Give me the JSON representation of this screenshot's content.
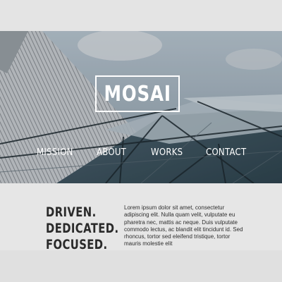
{
  "brand": {
    "logo_text": "MOSAI"
  },
  "nav": {
    "items": [
      {
        "label": "MISSION"
      },
      {
        "label": "ABOUT"
      },
      {
        "label": "WORKS"
      },
      {
        "label": "CONTACT"
      }
    ]
  },
  "tagline": {
    "lines": [
      "DRIVEN.",
      "DEDICATED.",
      "FOCUSED."
    ]
  },
  "intro_text": "Lorem ipsum dolor sit amet, consectetur adipiscing elit. Nulla quam velit, vulputate eu pharetra nec, mattis ac neque. Duis vulputate commodo lectus, ac blandit elit tincidunt id. Sed rhoncus, tortor sed eleifend tristique, tortor mauris molestie elit",
  "colors": {
    "text_light": "#ffffff",
    "text_dark": "#2a2a2a",
    "page_bg": "#e4e4e4"
  }
}
